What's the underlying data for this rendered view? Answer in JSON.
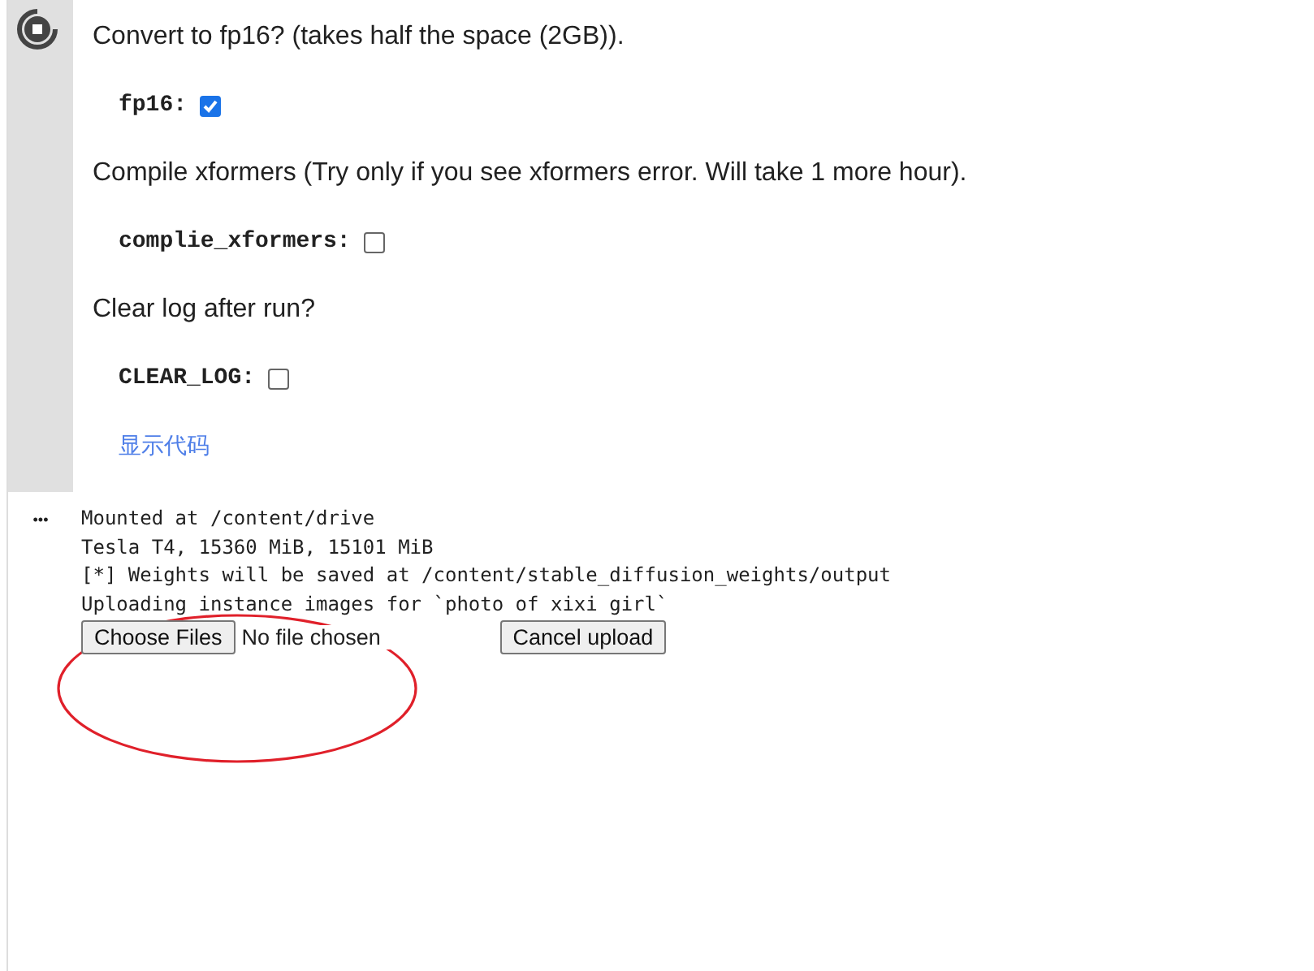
{
  "form": {
    "items": [
      {
        "kind": "text",
        "text": "Convert to fp16? (takes half the space (2GB))."
      },
      {
        "kind": "checkbox",
        "label": "fp16:",
        "checked": true
      },
      {
        "kind": "text",
        "text": "Compile xformers (Try only if you see xformers error. Will take 1 more hour)."
      },
      {
        "kind": "checkbox",
        "label": "complie_xformers:",
        "checked": false
      },
      {
        "kind": "text",
        "text": "Clear log after run?"
      },
      {
        "kind": "checkbox",
        "label": "CLEAR_LOG:",
        "checked": false
      },
      {
        "kind": "link",
        "text": "显示代码"
      }
    ]
  },
  "output": {
    "menu": "•••",
    "lines": [
      "Mounted at /content/drive",
      "Tesla T4, 15360 MiB, 15101 MiB",
      "[*] Weights will be saved at /content/stable_diffusion_weights/output",
      "Uploading instance images for `photo of xixi girl`"
    ],
    "upload": {
      "choose_button": "Choose Files",
      "status": "No file chosen",
      "cancel_button": "Cancel upload"
    }
  }
}
